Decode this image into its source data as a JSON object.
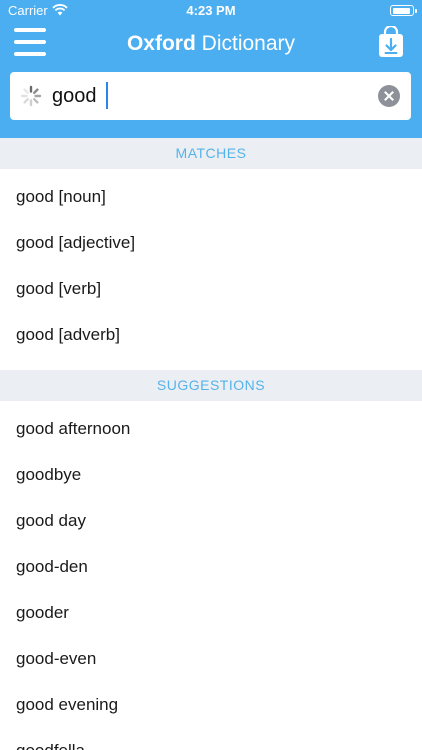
{
  "status_bar": {
    "carrier": "Carrier",
    "time": "4:23 PM"
  },
  "header": {
    "title_bold": "Oxford",
    "title_regular": " Dictionary",
    "menu_icon": "hamburger-menu-icon",
    "download_icon": "download-bag-icon",
    "background_color": "#4aaef1"
  },
  "search": {
    "value": "good",
    "loading_icon": "spinner-icon",
    "clear_icon": "clear-icon"
  },
  "matches": {
    "header": "MATCHES",
    "items": [
      {
        "label": "good [noun]"
      },
      {
        "label": "good [adjective]"
      },
      {
        "label": "good [verb]"
      },
      {
        "label": "good [adverb]"
      }
    ]
  },
  "suggestions": {
    "header": "SUGGESTIONS",
    "items": [
      {
        "label": "good afternoon"
      },
      {
        "label": "goodbye"
      },
      {
        "label": "good day"
      },
      {
        "label": "good-den"
      },
      {
        "label": "gooder"
      },
      {
        "label": "good-even"
      },
      {
        "label": "good evening"
      },
      {
        "label": "goodfella"
      }
    ]
  },
  "colors": {
    "accent": "#4aaef1",
    "section_text": "#55b3ea",
    "section_background": "#ebeff3"
  }
}
